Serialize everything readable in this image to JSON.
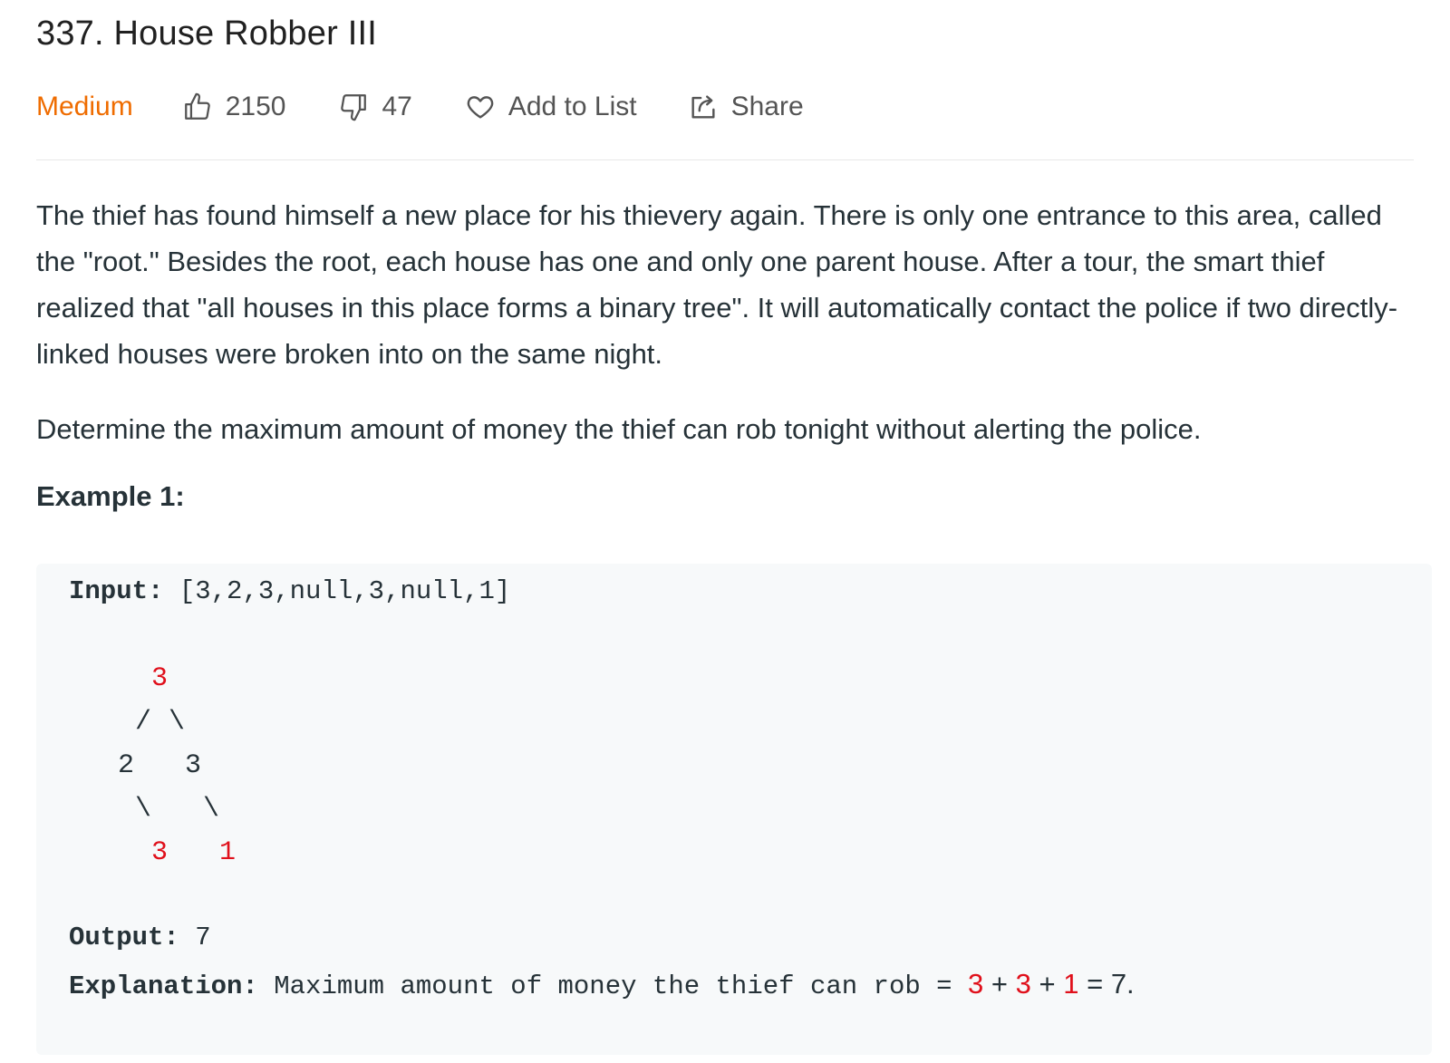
{
  "problem": {
    "title": "337. House Robber III",
    "difficulty": "Medium",
    "likes": "2150",
    "dislikes": "47",
    "add_to_list": "Add to List",
    "share": "Share"
  },
  "description": {
    "paragraph1": "The thief has found himself a new place for his thievery again. There is only one entrance to this area, called the \"root.\" Besides the root, each house has one and only one parent house. After a tour, the smart thief realized that \"all houses in this place forms a binary tree\". It will automatically contact the police if two directly-linked houses were broken into on the same night.",
    "paragraph2": "Determine the maximum amount of money the thief can rob tonight without alerting the police."
  },
  "example1": {
    "heading": "Example 1:",
    "input_label": "Input:",
    "input_value": "[3,2,3,null,3,null,1]",
    "tree": {
      "root": "3",
      "left": "2",
      "right": "3",
      "left_right": "3",
      "right_right": "1",
      "slash": "/",
      "backslash": "\\"
    },
    "output_label": "Output:",
    "output_value": "7",
    "explanation_label": "Explanation:",
    "explanation_text": "Maximum amount of money the thief can rob =",
    "sum_a": "3",
    "sum_b": "3",
    "sum_c": "1",
    "plus": "+",
    "equals": "=",
    "result": "7."
  },
  "colors": {
    "difficulty_medium": "#ef6c00",
    "highlight_red": "#e0101b",
    "code_background": "#f7f9fa"
  },
  "icons": {
    "like": "thumbs-up-icon",
    "dislike": "thumbs-down-icon",
    "favorite": "heart-icon",
    "share": "share-icon"
  }
}
